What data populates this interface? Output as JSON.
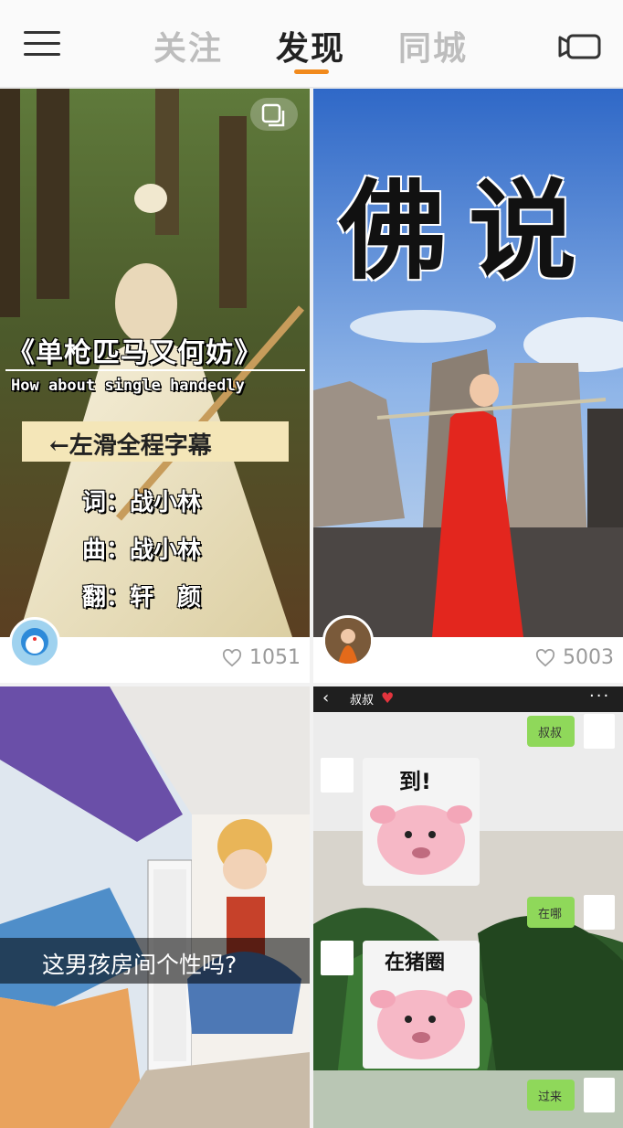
{
  "header": {
    "tabs": [
      {
        "label": "关注"
      },
      {
        "label": "发现"
      },
      {
        "label": "同城"
      }
    ]
  },
  "feed": [
    {
      "likes": "1051",
      "overlay": {
        "title": "《单枪匹马又何妨》",
        "subtitle": "How about single handedly",
        "swipe_hint": "←左滑全程字幕",
        "lyrics": "词：战小林",
        "music": "曲：战小林",
        "cover": "翻：轩　颜"
      }
    },
    {
      "likes": "5003",
      "overlay": {
        "calligraphy": "佛说"
      }
    },
    {
      "caption": "这男孩房间个性吗?"
    },
    {
      "chat": {
        "contact": "叔叔",
        "messages": [
          {
            "side": "right",
            "text": "叔叔"
          },
          {
            "side": "left",
            "sticker": "到!"
          },
          {
            "side": "right",
            "text": "在哪"
          },
          {
            "side": "left",
            "sticker": "在猪圈"
          },
          {
            "side": "right",
            "text": "过来"
          }
        ]
      }
    }
  ],
  "colors": {
    "accent": "#f18a1c",
    "tab_inactive": "#bdbdbd",
    "tab_active": "#222222"
  },
  "icons": {
    "menu": "hamburger-icon",
    "camera": "video-camera-icon",
    "like": "heart-outline-icon",
    "multi": "multi-image-icon"
  }
}
